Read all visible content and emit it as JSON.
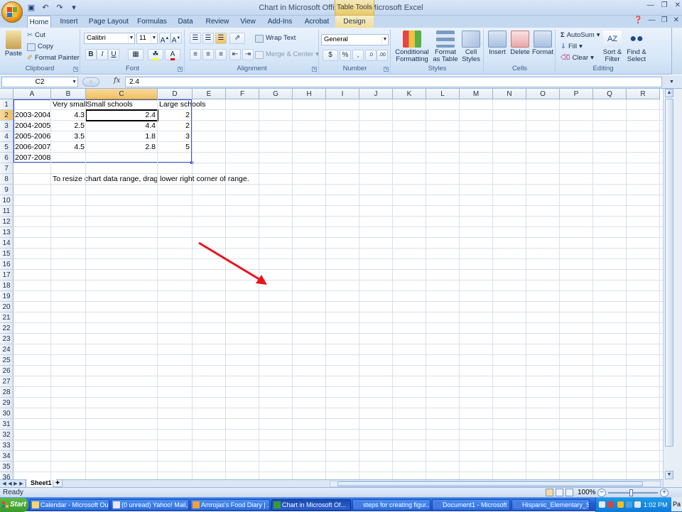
{
  "window": {
    "title": "Chart in Microsoft Office Word - Microsoft Excel",
    "context_tab_group": "Table Tools"
  },
  "tabs": [
    "Home",
    "Insert",
    "Page Layout",
    "Formulas",
    "Data",
    "Review",
    "Add-Ins",
    "Acrobat",
    "Design"
  ],
  "active_tab": "Home",
  "ribbon": {
    "clipboard": {
      "paste": "Paste",
      "cut": "Cut",
      "copy": "Copy",
      "format_painter": "Format Painter",
      "label": "Clipboard"
    },
    "font": {
      "name": "Calibri",
      "size": "11",
      "label": "Font",
      "bold": "B",
      "italic": "I",
      "underline": "U"
    },
    "alignment": {
      "wrap_text": "Wrap Text",
      "merge_center": "Merge & Center",
      "label": "Alignment"
    },
    "number": {
      "format": "General",
      "currency": "$",
      "percent": "%",
      "comma": ",",
      "label": "Number"
    },
    "styles": {
      "conditional_1": "Conditional",
      "conditional_2": "Formatting",
      "format_table_1": "Format",
      "format_table_2": "as Table",
      "cell_styles_1": "Cell",
      "cell_styles_2": "Styles",
      "label": "Styles"
    },
    "cells": {
      "insert": "Insert",
      "delete": "Delete",
      "format": "Format",
      "label": "Cells"
    },
    "editing": {
      "autosum": "AutoSum",
      "fill": "Fill",
      "clear": "Clear",
      "sort_1": "Sort &",
      "sort_2": "Filter",
      "find_1": "Find &",
      "find_2": "Select",
      "label": "Editing"
    }
  },
  "formula_bar": {
    "name_box": "C2",
    "fx": "fx",
    "value": "2.4"
  },
  "columns": [
    "A",
    "B",
    "C",
    "D",
    "E",
    "F",
    "G",
    "H",
    "I",
    "J",
    "K",
    "L",
    "M",
    "N",
    "O",
    "P",
    "Q",
    "R"
  ],
  "rows": [
    "1",
    "2",
    "3",
    "4",
    "5",
    "6",
    "7",
    "8",
    "9",
    "10",
    "11",
    "12",
    "13",
    "14",
    "15",
    "16",
    "17",
    "18",
    "19",
    "20",
    "21",
    "22",
    "23",
    "24",
    "25",
    "26",
    "27",
    "28",
    "29",
    "30",
    "31",
    "32",
    "33",
    "34",
    "35",
    "36"
  ],
  "sheet": {
    "headers": {
      "b1": "Very small",
      "c1": "Small schools",
      "d1": "Large schools"
    },
    "years": [
      "2003-2004",
      "2004-2005",
      "2005-2006",
      "2006-2007",
      "2007-2008"
    ],
    "very_small": [
      "4.3",
      "2.5",
      "3.5",
      "4.5"
    ],
    "small": [
      "2.4",
      "4.4",
      "1.8",
      "2.8"
    ],
    "large": [
      "2",
      "2",
      "3",
      "5"
    ],
    "note": "To resize chart data range, drag lower right corner of range."
  },
  "sheet_tab": "Sheet1",
  "status": {
    "ready": "Ready",
    "zoom": "100%"
  },
  "taskbar": {
    "start": "Start",
    "items": [
      "Calendar - Microsoft Ou...",
      "(0 unread) Yahoo! Mail,...",
      "Amrojas's Food Diary | ...",
      "Chart in Microsoft Of...",
      "steps for creating figur...",
      "Document1 - Microsoft ...",
      "Hispanic_Elementary_S..."
    ],
    "clock": "1:02 PM",
    "edge": "Pa"
  },
  "colors": {
    "accent": "#f1c05e",
    "range_border": "#3b52c8",
    "arrow": "#e8141b"
  }
}
